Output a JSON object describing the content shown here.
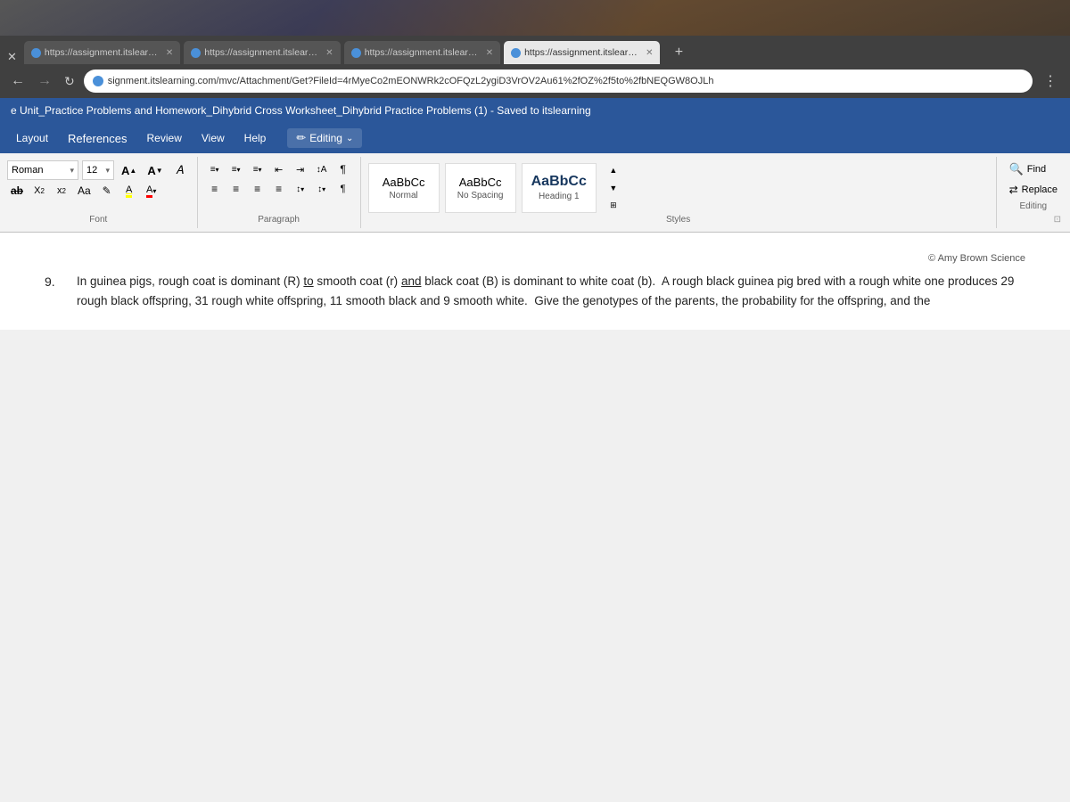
{
  "browser": {
    "tabs": [
      {
        "id": "tab1",
        "url": "https://assignment.itslearning.c...",
        "active": false,
        "globe_color": "#4a90d9"
      },
      {
        "id": "tab2",
        "url": "https://assignment.itslearning.c...",
        "active": false,
        "globe_color": "#4a90d9"
      },
      {
        "id": "tab3",
        "url": "https://assignment.itslearning.c...",
        "active": false,
        "globe_color": "#4a90d9"
      },
      {
        "id": "tab4",
        "url": "https://assignment.itslearning.c...",
        "active": true,
        "globe_color": "#4a90d9"
      }
    ],
    "address": "signment.itslearning.com/mvc/Attachment/Get?FileId=4rMyeCo2mEONWRk2cOFQzL2ygiD3VrOV2Au61%2fOZ%2f5to%2fbNEQGW8OJLh"
  },
  "document": {
    "title": "e Unit_Practice Problems and Homework_Dihybrid Cross Worksheet_Dihybrid Practice Problems (1) - Saved to itslearning"
  },
  "ribbon_menu": {
    "items": [
      "Layout",
      "References",
      "Review",
      "View",
      "Help"
    ],
    "editing_label": "Editing"
  },
  "ribbon": {
    "font_name": "Roman",
    "font_size": "12",
    "styles_label": "Styles",
    "font_label": "Font",
    "paragraph_label": "Paragraph",
    "editing_section_label": "Editing",
    "style_normal_preview": "AaBbCc",
    "style_normal_label": "Normal",
    "style_nospace_preview": "AaBbCc",
    "style_nospace_label": "No Spacing",
    "style_heading1_preview": "AaBbCc",
    "style_heading1_label": "Heading 1",
    "find_label": "Find",
    "replace_label": "Replace"
  },
  "content": {
    "copyright": "© Amy Brown Science",
    "paragraph_number": "9.",
    "paragraph_text": "In guinea pigs, rough coat is dominant (R) to smooth coat (r) and black coat (B) is dominant to white coat (b).  A rough black guinea pig bred with a rough white one produces 29 rough black offspring, 31 rough white offspring, 11 smooth black and 9 smooth white.  Give the genotypes of the parents, the probability for the offspring, and the",
    "underlined_word": "and"
  }
}
